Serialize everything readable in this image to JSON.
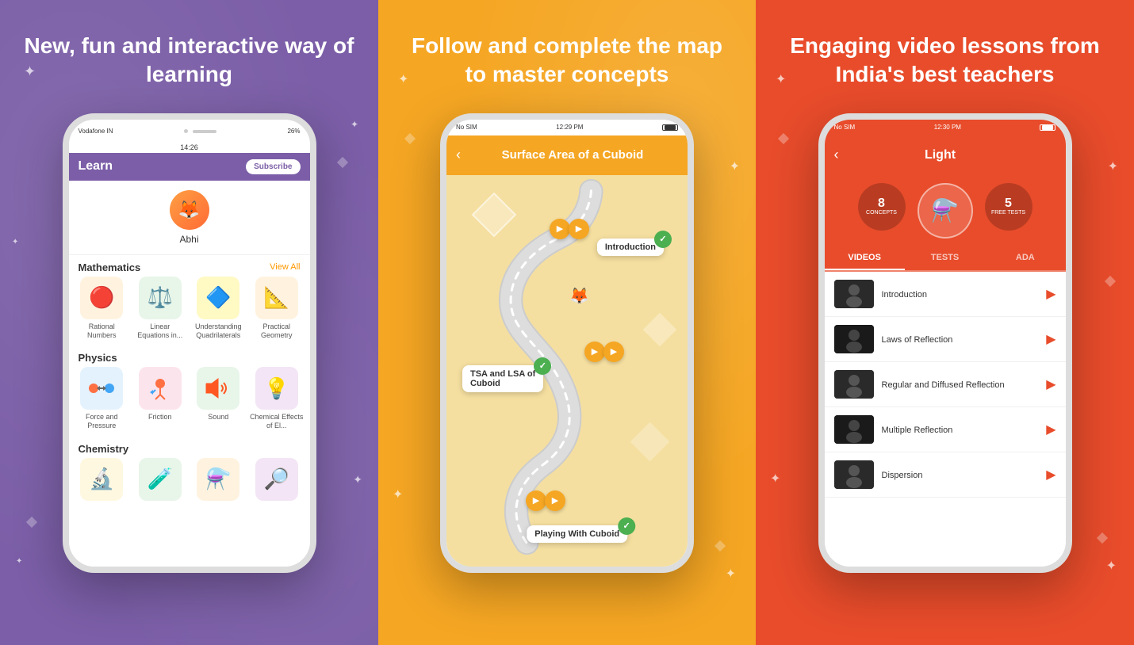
{
  "panel1": {
    "title": "New, fun and interactive way of learning",
    "background_color": "#7B5EA7",
    "phone": {
      "carrier": "Vodafone IN",
      "time": "14:26",
      "battery": "26%",
      "app_title": "Learn",
      "subscribe_label": "Subscribe",
      "user_name": "Abhi",
      "sections": [
        {
          "title": "Mathematics",
          "view_all": "View All",
          "subjects": [
            {
              "name": "Rational Numbers",
              "icon": "🔴"
            },
            {
              "name": "Linear Equations in...",
              "icon": "⚖️"
            },
            {
              "name": "Understanding Quadrilaterals",
              "icon": "🔷"
            },
            {
              "name": "Practical Geometry",
              "icon": "📐"
            }
          ]
        },
        {
          "title": "Physics",
          "subjects": [
            {
              "name": "Force and Pressure",
              "icon": "👥"
            },
            {
              "name": "Friction",
              "icon": "🏃"
            },
            {
              "name": "Sound",
              "icon": "〰️"
            },
            {
              "name": "Chemical Effects of El...",
              "icon": "💡"
            }
          ]
        },
        {
          "title": "Chemistry",
          "subjects": []
        }
      ]
    }
  },
  "panel2": {
    "title": "Follow and complete the map to master concepts",
    "background_color": "#F5A623",
    "phone": {
      "carrier": "No SIM",
      "time": "12:29 PM",
      "map_title": "Surface Area of a Cuboid",
      "nodes": [
        {
          "label": "Introduction",
          "status": "done"
        },
        {
          "label": "TSA and LSA of Cuboid",
          "status": "done"
        },
        {
          "label": "Playing With Cuboid",
          "status": "active"
        }
      ]
    }
  },
  "panel3": {
    "title": "Engaging video lessons from India's best teachers",
    "background_color": "#E84C2B",
    "phone": {
      "carrier": "No SIM",
      "time": "12:30 PM",
      "topic_title": "Light",
      "concepts_count": "8",
      "tests_count": "5",
      "concepts_label": "CONCEPTS",
      "free_tests_label": "FREE TESTS",
      "tabs": [
        "VIDEOS",
        "TESTS",
        "ADA"
      ],
      "active_tab": "VIDEOS",
      "videos": [
        {
          "title": "Introduction"
        },
        {
          "title": "Laws of Reflection"
        },
        {
          "title": "Regular and Diffused Reflection"
        },
        {
          "title": "Multiple Reflection"
        },
        {
          "title": "Dispersion"
        }
      ]
    }
  }
}
